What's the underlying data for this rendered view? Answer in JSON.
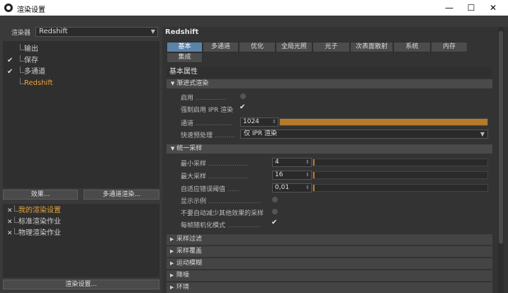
{
  "window": {
    "title": "渲染设置",
    "minimize": "—",
    "maximize": "☐",
    "close": "✕"
  },
  "left": {
    "renderer_label": "渲染器",
    "renderer_value": "Redshift",
    "items": [
      {
        "label": "输出",
        "checked": false,
        "active": false
      },
      {
        "label": "保存",
        "checked": true,
        "active": false
      },
      {
        "label": "多通道",
        "checked": true,
        "active": false
      },
      {
        "label": "Redshift",
        "checked": false,
        "active": true
      }
    ],
    "effects_button": "效果...",
    "multipass_button": "多通道渲染...",
    "settings": [
      {
        "label": "我的渲染设置",
        "active": true
      },
      {
        "label": "标准渲染作业",
        "active": false
      },
      {
        "label": "物理渲染作业",
        "active": false
      }
    ],
    "render_settings_button": "渲染设置..."
  },
  "right": {
    "header": "Redshift",
    "tabs_row1": [
      "基本",
      "多通道",
      "优化",
      "全局光照",
      "光子",
      "次表面散射",
      "系统",
      "内存"
    ],
    "tabs_row2": [
      "集成"
    ],
    "basic_attributes": "基本属性",
    "progressive": {
      "title": "渐进式渲染",
      "enable_label": "启用",
      "force_ipr_label": "强制启用 IPR 渲染",
      "passes_label": "通道",
      "passes_value": "1024",
      "passes_fill": 1.0,
      "preview_label": "快速预处理",
      "preview_value": "仅 IPR 渲染"
    },
    "unified": {
      "title": "统一采样",
      "min_label": "最小采样",
      "min_value": "4",
      "min_fill": 0.01,
      "max_label": "最大采样",
      "max_value": "16",
      "max_fill": 0.01,
      "threshold_label": "自适应错误阈值",
      "threshold_value": "0,01",
      "threshold_fill": 0.01,
      "show_samples_label": "显示示例",
      "no_reduce_label": "不要自动减少其他效果的采样",
      "random_label": "每帧随机化模式"
    },
    "collapsed_sections": [
      "采样过滤",
      "采样覆盖",
      "运动模糊",
      "降噪",
      "环境"
    ]
  },
  "colors": {
    "active_tab": "#5b83a8",
    "accent": "#e8a33a",
    "slider_fill": "#b67a2a"
  }
}
